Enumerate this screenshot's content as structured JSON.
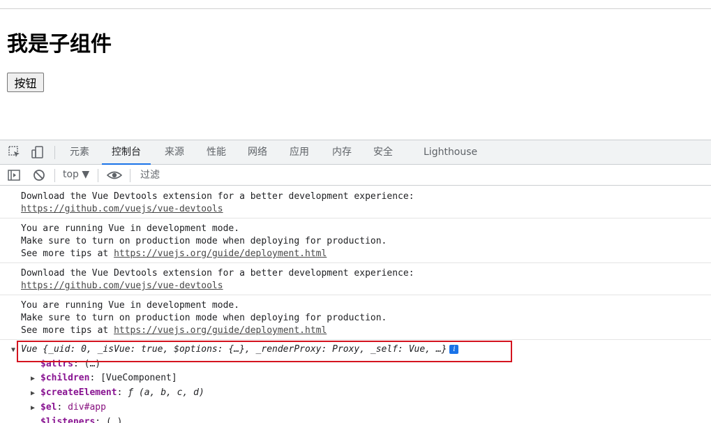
{
  "page": {
    "heading": "我是子组件",
    "button_label": "按钮"
  },
  "devtools": {
    "tabs": [
      "元素",
      "控制台",
      "来源",
      "性能",
      "网络",
      "应用",
      "内存",
      "安全",
      "Lighthouse"
    ],
    "active_tab": "控制台",
    "toolbar": {
      "context": "top ▼",
      "filter_placeholder": "过滤"
    },
    "messages": [
      {
        "lines": [
          "Download the Vue Devtools extension for a better development experience:"
        ],
        "link": "https://github.com/vuejs/vue-devtools",
        "link_prefix": ""
      },
      {
        "lines": [
          "You are running Vue in development mode.",
          "Make sure to turn on production mode when deploying for production."
        ],
        "link": "https://vuejs.org/guide/deployment.html",
        "link_prefix": "See more tips at "
      },
      {
        "lines": [
          "Download the Vue Devtools extension for a better development experience:"
        ],
        "link": "https://github.com/vuejs/vue-devtools",
        "link_prefix": ""
      },
      {
        "lines": [
          "You are running Vue in development mode.",
          "Make sure to turn on production mode when deploying for production."
        ],
        "link": "https://vuejs.org/guide/deployment.html",
        "link_prefix": "See more tips at "
      }
    ],
    "object": {
      "summary": "Vue {_uid: 0, _isVue: true, $options: {…}, _renderProxy: Proxy, _self: Vue, …}",
      "properties": [
        {
          "expand": "",
          "key": "$attrs",
          "value": "(…)"
        },
        {
          "expand": "▶",
          "key": "$children",
          "value": "[VueComponent]"
        },
        {
          "expand": "▶",
          "key": "$createElement",
          "value": "ƒ (a, b, c, d)"
        },
        {
          "expand": "▶",
          "key": "$el",
          "value": "div#app"
        },
        {
          "expand": "",
          "key": "$listeners",
          "value": "(…)"
        }
      ]
    }
  },
  "colors": {
    "highlight_box": "#d4141f",
    "active_tab_underline": "#1a73e8"
  }
}
